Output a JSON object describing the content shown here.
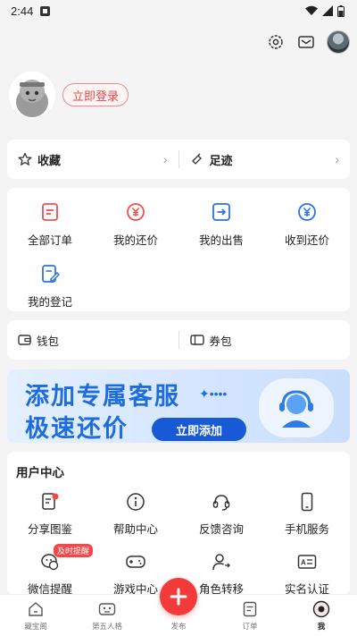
{
  "status_bar": {
    "time": "2:44"
  },
  "header_icons": [
    "settings-icon",
    "message-icon",
    "avatar"
  ],
  "profile": {
    "login_label": "立即登录"
  },
  "favorites": [
    {
      "label": "收藏",
      "icon": "star-icon"
    },
    {
      "label": "足迹",
      "icon": "footprint-icon"
    }
  ],
  "orders": [
    {
      "label": "全部订单",
      "icon": "order-list-icon",
      "color": "#f05050"
    },
    {
      "label": "我的还价",
      "icon": "yen-coin-icon",
      "color": "#f05050"
    },
    {
      "label": "我的出售",
      "icon": "sell-export-icon",
      "color": "#2a72e8"
    },
    {
      "label": "收到还价",
      "icon": "yen-coin-icon",
      "color": "#2a72e8"
    },
    {
      "label": "我的登记",
      "icon": "register-edit-icon",
      "color": "#2a72e8"
    }
  ],
  "wallet": [
    {
      "label": "钱包",
      "icon": "wallet-icon"
    },
    {
      "label": "券包",
      "icon": "coupon-icon"
    }
  ],
  "banner": {
    "line1": "添加专属客服",
    "line2": "极速还价",
    "button": "立即添加",
    "accent": "#1d6ce0"
  },
  "user_center": {
    "title": "用户中心",
    "items": [
      {
        "label": "分享图鉴",
        "icon": "share-album-icon"
      },
      {
        "label": "帮助中心",
        "icon": "info-circle-icon"
      },
      {
        "label": "反馈咨询",
        "icon": "headset-icon"
      },
      {
        "label": "手机服务",
        "icon": "phone-icon"
      },
      {
        "label": "微信提醒",
        "icon": "wechat-remind-icon",
        "badge": "及时提醒"
      },
      {
        "label": "游戏中心",
        "icon": "gamepad-icon"
      },
      {
        "label": "角色转移",
        "icon": "person-transfer-icon"
      },
      {
        "label": "实名认证",
        "icon": "id-card-icon"
      }
    ]
  },
  "bottom_nav": [
    {
      "label": "藏宝阁",
      "icon": "home-icon"
    },
    {
      "label": "第五人格",
      "icon": "game-face-icon"
    },
    {
      "label": "发布",
      "icon": "plus-icon"
    },
    {
      "label": "订单",
      "icon": "order-icon"
    },
    {
      "label": "我",
      "icon": "me-icon"
    }
  ],
  "colors": {
    "brand_red": "#f23a3a",
    "brand_blue": "#1859d6"
  }
}
